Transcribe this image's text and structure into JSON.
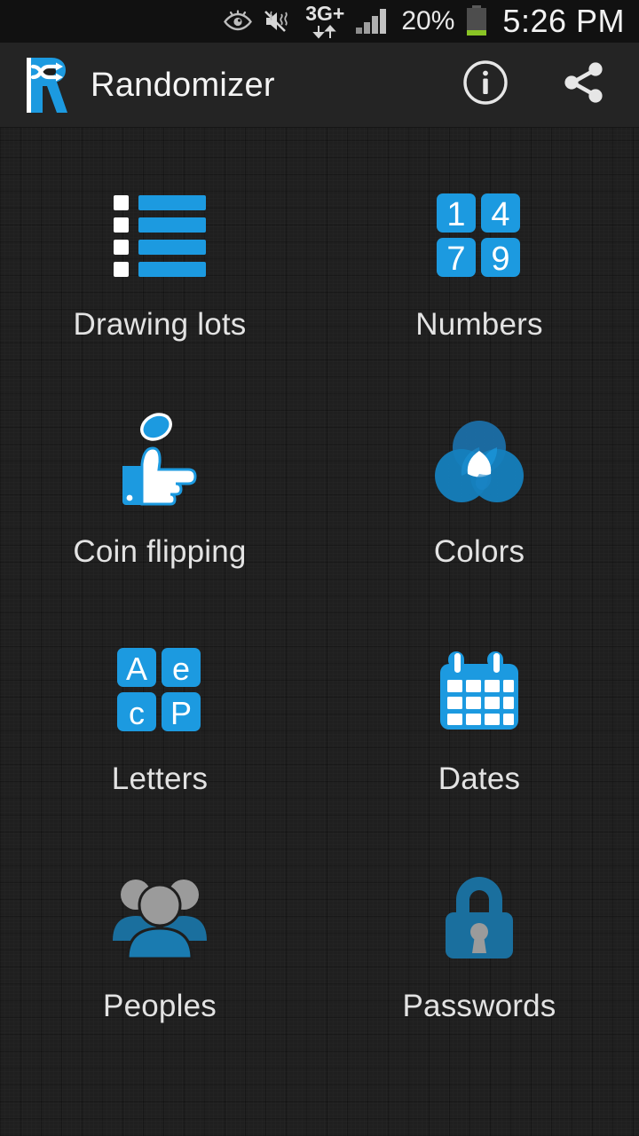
{
  "statusbar": {
    "icons": [
      "smart-stay-eye-icon",
      "mute-icon",
      "3g-plus-data-icon",
      "signal-bars-icon",
      "battery-icon"
    ],
    "network_label": "3G+",
    "battery_percent": "20%",
    "clock": "5:26 PM"
  },
  "appbar": {
    "logo_name": "randomizer-logo",
    "title": "Randomizer",
    "actions": [
      {
        "name": "info-button",
        "icon": "info-icon",
        "label": "Info"
      },
      {
        "name": "share-button",
        "icon": "share-icon",
        "label": "Share"
      }
    ]
  },
  "grid": {
    "items": [
      {
        "id": "drawing-lots",
        "label": "Drawing lots",
        "icon": "list-lots-icon"
      },
      {
        "id": "numbers",
        "label": "Numbers",
        "icon": "numbers-tiles-icon",
        "tiles": [
          "1",
          "4",
          "7",
          "9"
        ]
      },
      {
        "id": "coin-flipping",
        "label": "Coin flipping",
        "icon": "coin-flip-hand-icon"
      },
      {
        "id": "colors",
        "label": "Colors",
        "icon": "color-circles-icon"
      },
      {
        "id": "letters",
        "label": "Letters",
        "icon": "letters-tiles-icon",
        "tiles": [
          "A",
          "e",
          "c",
          "P"
        ]
      },
      {
        "id": "dates",
        "label": "Dates",
        "icon": "calendar-icon"
      },
      {
        "id": "peoples",
        "label": "Peoples",
        "icon": "people-group-icon"
      },
      {
        "id": "passwords",
        "label": "Passwords",
        "icon": "padlock-icon"
      }
    ]
  },
  "colors": {
    "accent_blue": "#1c9ae0",
    "deep_blue": "#1a6f9e",
    "gray": "#9b9b9b",
    "background": "#1f1f1f",
    "appbar": "#242424",
    "statusbar": "#111111",
    "text": "#e3e3e3",
    "battery_green": "#8ac425"
  }
}
